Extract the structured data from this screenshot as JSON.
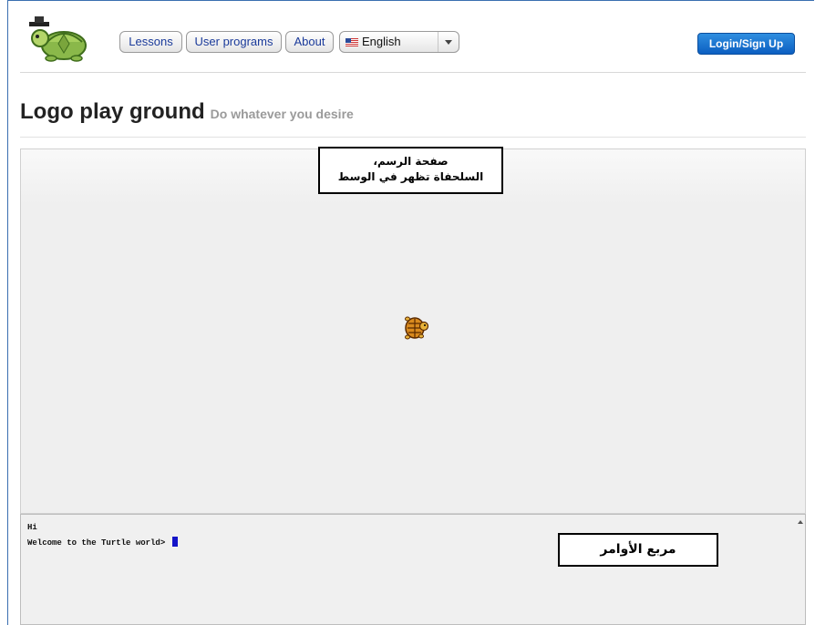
{
  "nav": {
    "lessons": "Lessons",
    "user_programs": "User programs",
    "about": "About",
    "language": "English",
    "login": "Login/Sign Up"
  },
  "page": {
    "title": "Logo play ground",
    "subtitle": "Do whatever you desire"
  },
  "annotations": {
    "canvas_line1": "صفحة الرسم،",
    "canvas_line2": "السلحفاة تظهر في الوسط",
    "console": "مربع الأوامر"
  },
  "console": {
    "line1": "Hi",
    "prompt": "Welcome to the Turtle world>"
  },
  "colors": {
    "login_bg": "#1b73d0",
    "nav_text": "#1a3a9a",
    "cursor": "#1414c8"
  }
}
